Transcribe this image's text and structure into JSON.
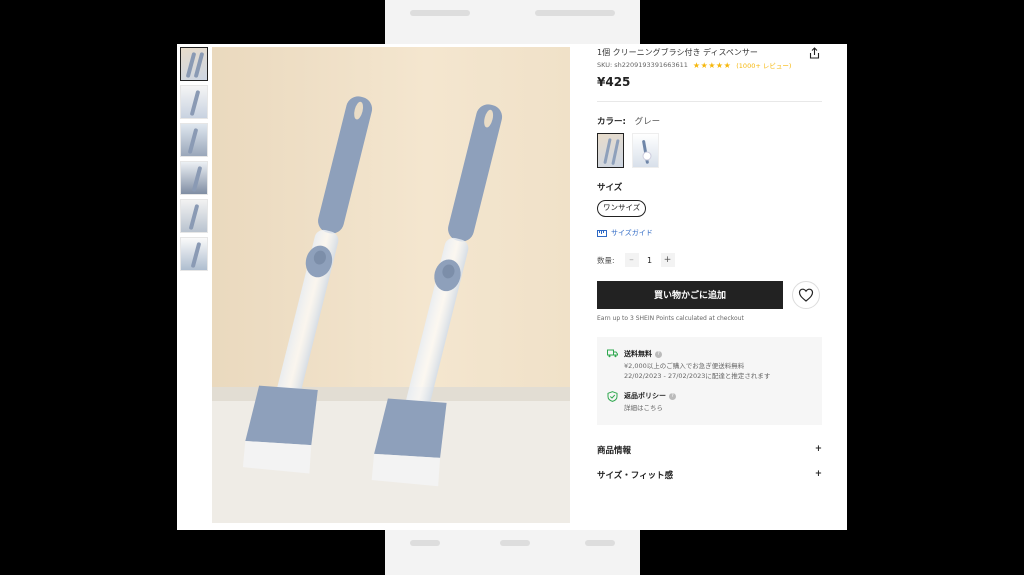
{
  "product": {
    "title": "1個 クリーニングブラシ付き ディスペンサー",
    "sku_label": "SKU: sh2209193391663611",
    "stars": "★★★★★",
    "reviews": "(1000+ レビュー)",
    "price": "¥425"
  },
  "color": {
    "label": "カラー:",
    "value": "グレー"
  },
  "size": {
    "label": "サイズ",
    "option": "ワンサイズ",
    "guide": "サイズガイド"
  },
  "quantity": {
    "label": "数量:",
    "minus": "–",
    "value": "1",
    "plus": "+"
  },
  "cart": {
    "add_label": "買い物かごに追加",
    "earn_text": "Earn up to 3 SHEIN Points calculated at checkout"
  },
  "shipping": {
    "title": "送料無料",
    "line1": "¥2,000以上のご購入でお急ぎ便送料無料",
    "line2": "22/02/2023 - 27/02/2023に配達と推定されます"
  },
  "returns": {
    "title": "返品ポリシー",
    "line1": "詳細はこちら"
  },
  "sections": {
    "product_info": "商品情報",
    "size_fit": "サイズ・フィット感",
    "expand": "+"
  },
  "colors": {
    "accent": "#222222",
    "star": "#f6b70b",
    "link": "#2d68c4",
    "shipping_icon": "#2fa84f"
  }
}
